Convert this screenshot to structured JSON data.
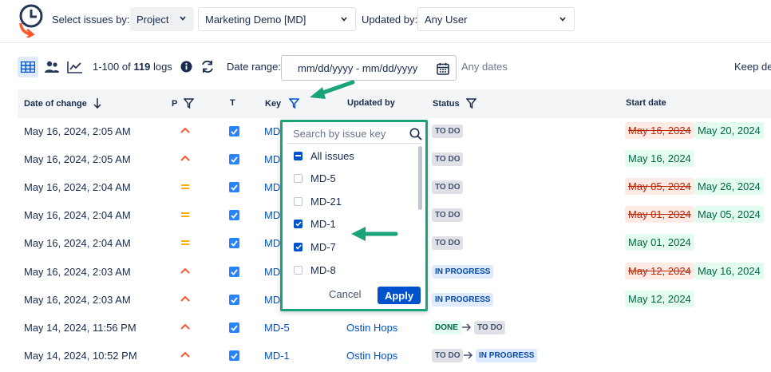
{
  "topbar": {
    "select_issues_label": "Select issues by:",
    "issues_by_value": "Project",
    "project_value": "Marketing Demo [MD]",
    "updated_by_label": "Updated by:",
    "updated_by_value": "Any User"
  },
  "toolbar": {
    "range": "1-100",
    "of": "of",
    "total": "119",
    "logs": "logs",
    "date_range_label": "Date range:",
    "date_placeholder": "mm/dd/yyyy - mm/dd/yyyy",
    "any_dates": "Any dates",
    "keep_label": "Keep de"
  },
  "columns": {
    "date": "Date of change",
    "p": "P",
    "t": "T",
    "key": "Key",
    "updated_by": "Updated by",
    "status": "Status",
    "start_date": "Start date"
  },
  "rows": [
    {
      "date": "May 16, 2024, 2:05 AM",
      "priority": "high",
      "key": "MD-",
      "updated_by": "",
      "status_from": "TO DO",
      "status_to": "",
      "start_old": "May 16, 2024",
      "start_new": "May 20, 2024"
    },
    {
      "date": "May 16, 2024, 2:05 AM",
      "priority": "high",
      "key": "MD-",
      "updated_by": "",
      "status_from": "TO DO",
      "status_to": "",
      "start_old": "",
      "start_new": "May 16, 2024"
    },
    {
      "date": "May 16, 2024, 2:04 AM",
      "priority": "medium",
      "key": "MD-",
      "updated_by": "",
      "status_from": "TO DO",
      "status_to": "",
      "start_old": "May 05, 2024",
      "start_new": "May 26, 2024"
    },
    {
      "date": "May 16, 2024, 2:04 AM",
      "priority": "medium",
      "key": "MD-",
      "updated_by": "",
      "status_from": "TO DO",
      "status_to": "",
      "start_old": "May 01, 2024",
      "start_new": "May 05, 2024"
    },
    {
      "date": "May 16, 2024, 2:04 AM",
      "priority": "medium",
      "key": "MD-",
      "updated_by": "",
      "status_from": "TO DO",
      "status_to": "",
      "start_old": "",
      "start_new": "May 01, 2024"
    },
    {
      "date": "May 16, 2024, 2:03 AM",
      "priority": "high",
      "key": "MD-",
      "updated_by": "",
      "status_from": "IN PROGRESS",
      "status_to": "",
      "start_old": "May 12, 2024",
      "start_new": "May 16, 2024"
    },
    {
      "date": "May 16, 2024, 2:03 AM",
      "priority": "high",
      "key": "MD-",
      "updated_by": "",
      "status_from": "IN PROGRESS",
      "status_to": "",
      "start_old": "",
      "start_new": "May 12, 2024"
    },
    {
      "date": "May 14, 2024, 11:56 PM",
      "priority": "high",
      "key": "MD-5",
      "updated_by": "Ostin Hops",
      "status_from": "DONE",
      "status_to": "TO DO",
      "start_old": "",
      "start_new": ""
    },
    {
      "date": "May 14, 2024, 10:52 PM",
      "priority": "high",
      "key": "MD-1",
      "updated_by": "Ostin Hops",
      "status_from": "TO DO",
      "status_to": "IN PROGRESS",
      "start_old": "",
      "start_new": ""
    }
  ],
  "key_filter": {
    "search_placeholder": "Search by issue key",
    "options": [
      {
        "label": "All issues",
        "state": "indeterminate"
      },
      {
        "label": "MD-5",
        "state": "unchecked"
      },
      {
        "label": "MD-21",
        "state": "unchecked"
      },
      {
        "label": "MD-1",
        "state": "checked"
      },
      {
        "label": "MD-7",
        "state": "checked"
      },
      {
        "label": "MD-8",
        "state": "unchecked"
      }
    ],
    "cancel": "Cancel",
    "apply": "Apply"
  },
  "colors": {
    "accent": "#0052cc",
    "annotation": "#1aa37a",
    "priority_high": "#ff5630",
    "priority_medium": "#ffab00"
  }
}
